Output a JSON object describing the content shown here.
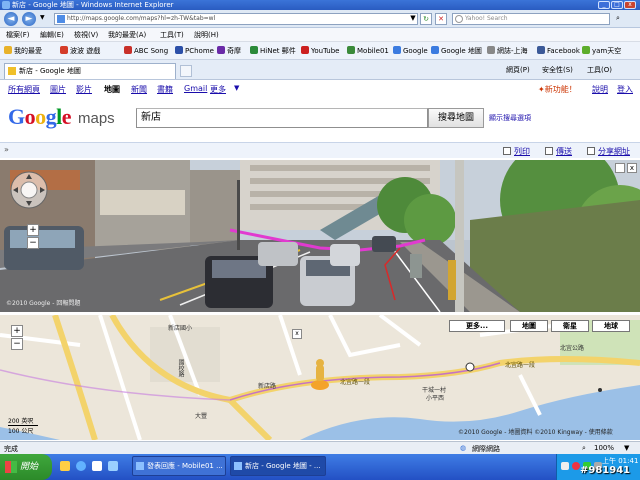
{
  "window": {
    "title": "新店 - Google 地圖 - Windows Internet Explorer"
  },
  "address": {
    "url": "http://maps.google.com/maps?hl=zh-TW&tab=wl",
    "search_placeholder": "Yahoo! Search"
  },
  "menu": [
    "檔案(F)",
    "編輯(E)",
    "檢視(V)",
    "我的最愛(A)",
    "工具(T)",
    "說明(H)"
  ],
  "favorites": [
    {
      "label": "我的最愛",
      "color": "#e8b22a"
    },
    {
      "label": "波波 遊戲",
      "color": "#d43c2a"
    },
    {
      "label": "ABC Song",
      "color": "#c8302a"
    },
    {
      "label": "PChome",
      "color": "#2b4fa8"
    },
    {
      "label": "奇摩",
      "color": "#6a2aa8"
    },
    {
      "label": "HiNet 郵件",
      "color": "#2b8a3a"
    },
    {
      "label": "YouTube",
      "color": "#cc2020"
    },
    {
      "label": "Mobile01",
      "color": "#3a8a3a"
    },
    {
      "label": "Google",
      "color": "#3b7be0"
    },
    {
      "label": "Google 地圖",
      "color": "#3b7be0"
    },
    {
      "label": "網誌-上海",
      "color": "#888888"
    },
    {
      "label": "Facebook",
      "color": "#3b5998"
    },
    {
      "label": "yam天空",
      "color": "#5cad2c"
    }
  ],
  "tab": {
    "title": "新店 - Google 地圖"
  },
  "commands": [
    "網頁(P)",
    "安全性(S)",
    "工具(O)"
  ],
  "google_links": {
    "items": [
      "所有網頁",
      "圖片",
      "影片",
      "地圖",
      "新聞",
      "書籍",
      "Gmail",
      "更多"
    ],
    "active": "地圖",
    "new_feature": "新功能！",
    "help": "說明",
    "login": "登入"
  },
  "maps": {
    "logo_word": "maps",
    "query": "新店",
    "search_button": "搜尋地圖",
    "options": "顯示搜尋選項"
  },
  "share": {
    "print": "列印",
    "send": "傳送",
    "link": "分享網址"
  },
  "streetview": {
    "copyright": "©2010 Google - 回報問題"
  },
  "map": {
    "buttons": [
      "更多...",
      "地圖",
      "衛星",
      "地球"
    ],
    "labels": [
      "新店國小",
      "國校路",
      "新店路",
      "北宜路一段",
      "北宜路一段",
      "干城一村",
      "小平西",
      "大豐",
      "北宜公路"
    ],
    "scale": [
      "200 英呎",
      "100 公尺"
    ],
    "copyright": "©2010 Google - 地圖資料 ©2010 Kingway - 使用條款"
  },
  "status": {
    "left": "完成",
    "zone": "網際網路",
    "zoom": "100%"
  },
  "taskbar": {
    "start": "開始",
    "items": [
      "發表回應 - Mobile01 ...",
      "新店 - Google 地圖 - ..."
    ],
    "clock": "上午 01:41"
  },
  "watermark": "#981941"
}
